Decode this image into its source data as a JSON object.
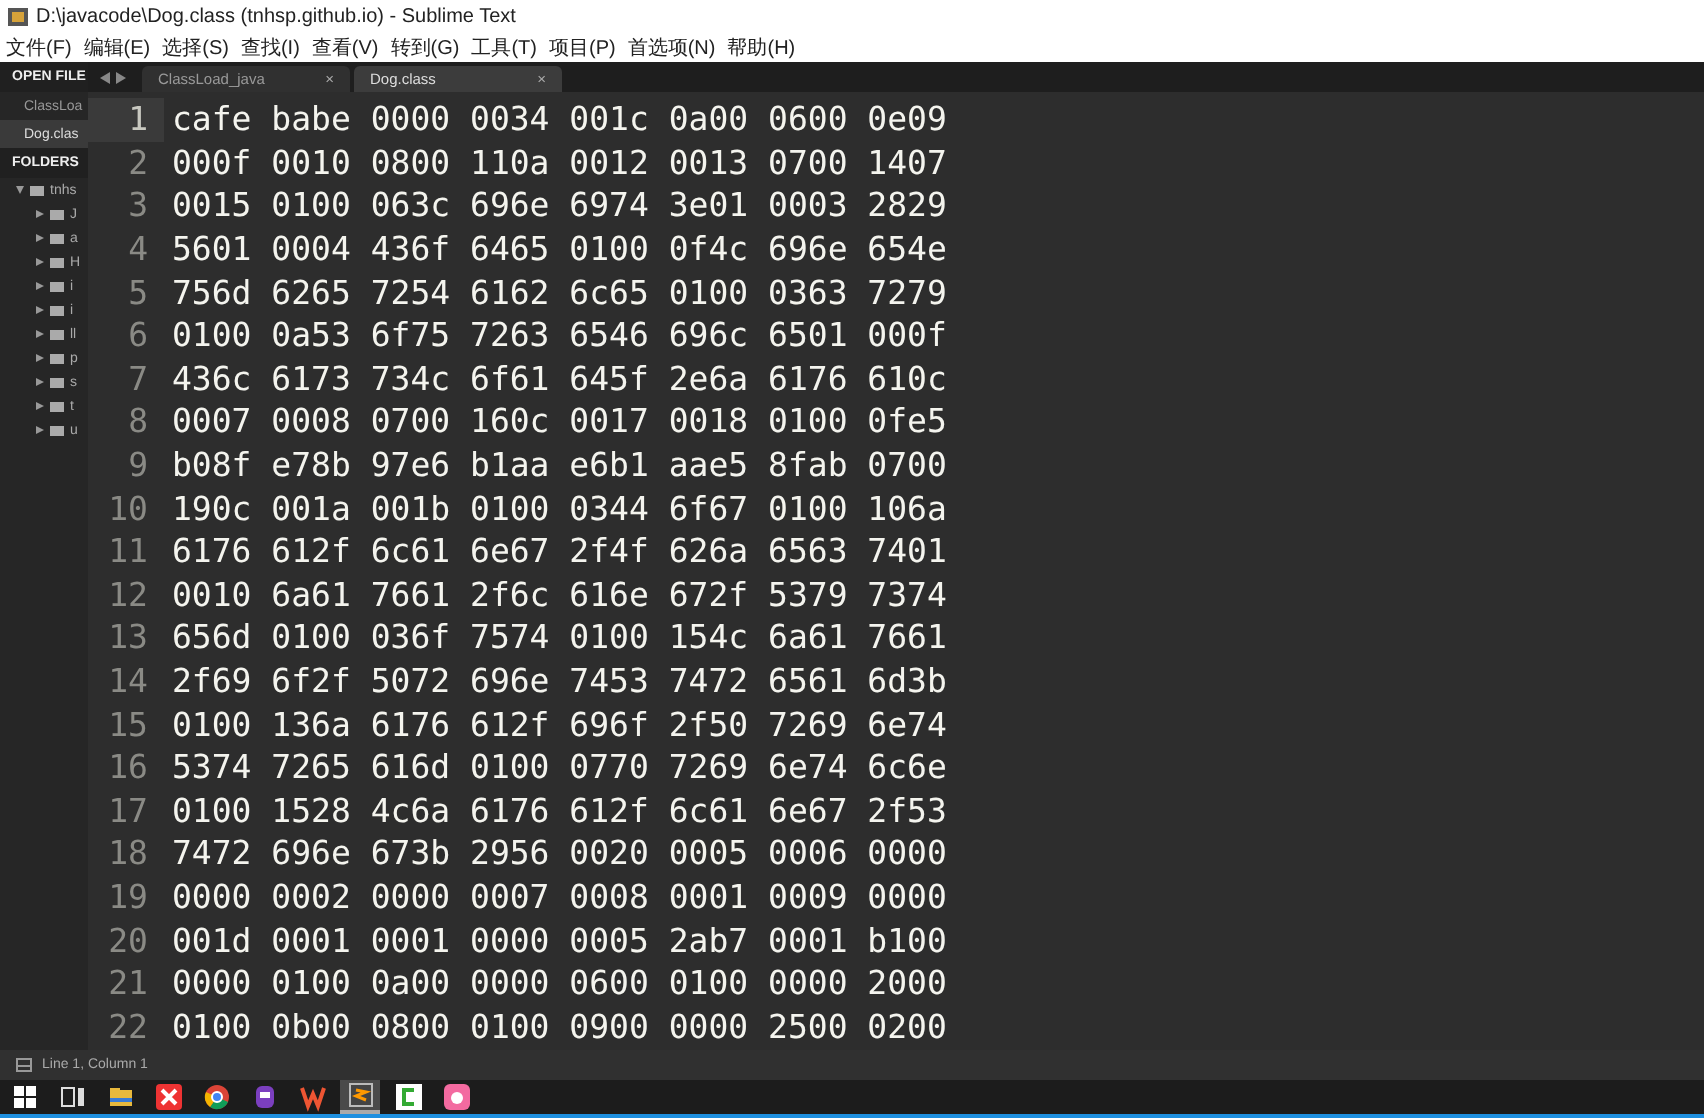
{
  "window": {
    "title": "D:\\javacode\\Dog.class (tnhsp.github.io) - Sublime Text"
  },
  "menu": [
    "文件(F)",
    "编辑(E)",
    "选择(S)",
    "查找(I)",
    "查看(V)",
    "转到(G)",
    "工具(T)",
    "项目(P)",
    "首选项(N)",
    "帮助(H)"
  ],
  "sidebar": {
    "open_files_heading": "OPEN FILE",
    "open_files": [
      {
        "label": "ClassLoa",
        "selected": false
      },
      {
        "label": "Dog.clas",
        "selected": true
      }
    ],
    "folders_heading": "FOLDERS",
    "tree": [
      {
        "label": "tnhs",
        "expanded": true,
        "children": [
          {
            "label": "J",
            "expanded": false
          },
          {
            "label": "a",
            "expanded": false
          },
          {
            "label": "H",
            "expanded": false
          },
          {
            "label": "i",
            "expanded": false
          },
          {
            "label": "i",
            "expanded": false
          },
          {
            "label": "ll",
            "expanded": false
          },
          {
            "label": "p",
            "expanded": false
          },
          {
            "label": "s",
            "expanded": false
          },
          {
            "label": "t",
            "expanded": false
          },
          {
            "label": "u",
            "expanded": false
          }
        ]
      }
    ]
  },
  "tabs": [
    {
      "label": "ClassLoad_java",
      "close": "×",
      "selected": false
    },
    {
      "label": "Dog.class",
      "close": "×",
      "selected": true
    }
  ],
  "editor": {
    "lines": [
      {
        "number": "1",
        "text": "cafe babe 0000 0034 001c 0a00 0600 0e09",
        "current": true
      },
      {
        "number": "2",
        "text": "000f 0010 0800 110a 0012 0013 0700 1407",
        "current": false
      },
      {
        "number": "3",
        "text": "0015 0100 063c 696e 6974 3e01 0003 2829",
        "current": false
      },
      {
        "number": "4",
        "text": "5601 0004 436f 6465 0100 0f4c 696e 654e",
        "current": false
      },
      {
        "number": "5",
        "text": "756d 6265 7254 6162 6c65 0100 0363 7279",
        "current": false
      },
      {
        "number": "6",
        "text": "0100 0a53 6f75 7263 6546 696c 6501 000f",
        "current": false
      },
      {
        "number": "7",
        "text": "436c 6173 734c 6f61 645f 2e6a 6176 610c",
        "current": false
      },
      {
        "number": "8",
        "text": "0007 0008 0700 160c 0017 0018 0100 0fe5",
        "current": false
      },
      {
        "number": "9",
        "text": "b08f e78b 97e6 b1aa e6b1 aae5 8fab 0700",
        "current": false
      },
      {
        "number": "10",
        "text": "190c 001a 001b 0100 0344 6f67 0100 106a",
        "current": false
      },
      {
        "number": "11",
        "text": "6176 612f 6c61 6e67 2f4f 626a 6563 7401",
        "current": false
      },
      {
        "number": "12",
        "text": "0010 6a61 7661 2f6c 616e 672f 5379 7374",
        "current": false
      },
      {
        "number": "13",
        "text": "656d 0100 036f 7574 0100 154c 6a61 7661",
        "current": false
      },
      {
        "number": "14",
        "text": "2f69 6f2f 5072 696e 7453 7472 6561 6d3b",
        "current": false
      },
      {
        "number": "15",
        "text": "0100 136a 6176 612f 696f 2f50 7269 6e74",
        "current": false
      },
      {
        "number": "16",
        "text": "5374 7265 616d 0100 0770 7269 6e74 6c6e",
        "current": false
      },
      {
        "number": "17",
        "text": "0100 1528 4c6a 6176 612f 6c61 6e67 2f53",
        "current": false
      },
      {
        "number": "18",
        "text": "7472 696e 673b 2956 0020 0005 0006 0000",
        "current": false
      },
      {
        "number": "19",
        "text": "0000 0002 0000 0007 0008 0001 0009 0000",
        "current": false
      },
      {
        "number": "20",
        "text": "001d 0001 0001 0000 0005 2ab7 0001 b100",
        "current": false
      },
      {
        "number": "21",
        "text": "0000 0100 0a00 0000 0600 0100 0000 2000",
        "current": false
      },
      {
        "number": "22",
        "text": "0100 0b00 0800 0100 0900 0000 2500 0200",
        "current": false
      }
    ]
  },
  "status_bar": {
    "position": "Line 1, Column 1"
  },
  "taskbar": [
    {
      "kind": "start",
      "selected": false
    },
    {
      "kind": "taskview",
      "selected": false
    },
    {
      "kind": "folder",
      "selected": false
    },
    {
      "kind": "xmind",
      "selected": false
    },
    {
      "kind": "browser",
      "selected": false
    },
    {
      "kind": "robot",
      "selected": false
    },
    {
      "kind": "wps",
      "selected": false
    },
    {
      "kind": "editor",
      "selected": true
    },
    {
      "kind": "cterm",
      "selected": false
    },
    {
      "kind": "pink",
      "selected": false
    }
  ]
}
